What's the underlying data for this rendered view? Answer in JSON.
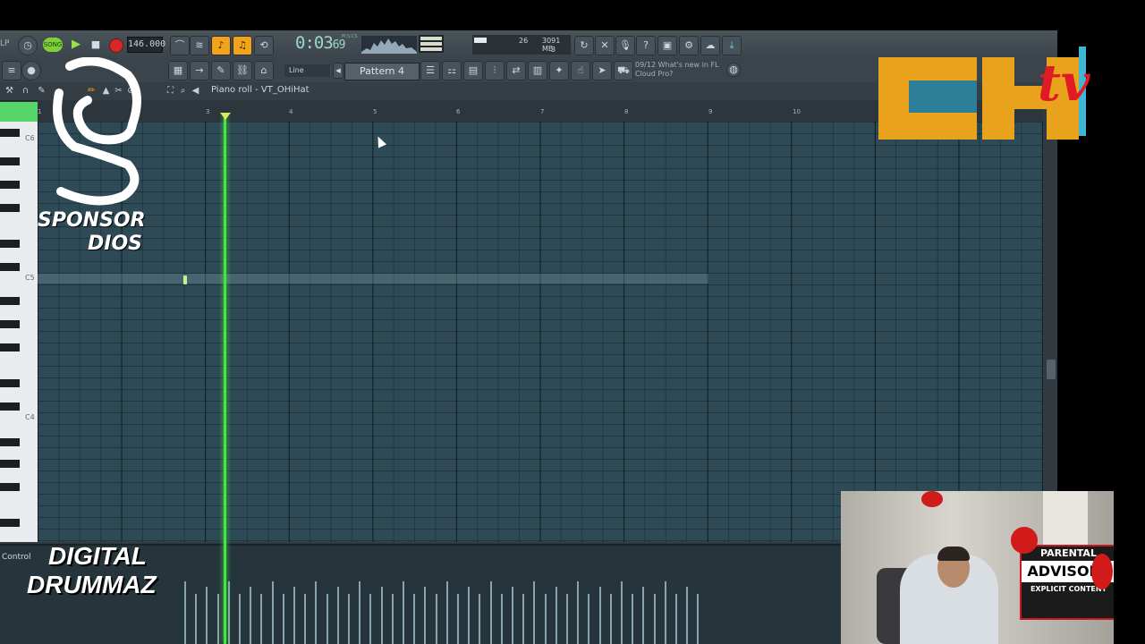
{
  "transport": {
    "song_label": "SONG",
    "left_label": "LP",
    "tempo": "146.000",
    "time": "0:03",
    "time_ms": "69",
    "time_unit": "M:S:CS",
    "cpu": "26",
    "memory": "3091 MB",
    "polyphony": "3",
    "pattern": "Pattern 4",
    "snap": "Line",
    "news_line1": "09/12  What's new in FL",
    "news_line2": "Cloud Pro?"
  },
  "piano_roll": {
    "title": "Piano roll - VT_OHiHat",
    "ruler": [
      "1",
      "3",
      "4",
      "5",
      "6",
      "7",
      "8",
      "9",
      "10"
    ],
    "key_labels": [
      "C6",
      "C5",
      "C4"
    ],
    "control_label": "Control"
  },
  "overlays": {
    "sponsor_line1": "SPONSOR",
    "sponsor_line2": "DIOS",
    "digital": "DIGITAL",
    "drummaz": "DRUMMAZ",
    "chtv_ch": "CH",
    "chtv_tv": "tv",
    "parental_line1": "PARENTAL",
    "parental_line2": "ADVISORY",
    "parental_line3": "EXPLICIT CONTENT"
  },
  "colors": {
    "playhead": "#48e24a",
    "accent_orange": "#f2a21b",
    "grid": "#2d4a56"
  }
}
